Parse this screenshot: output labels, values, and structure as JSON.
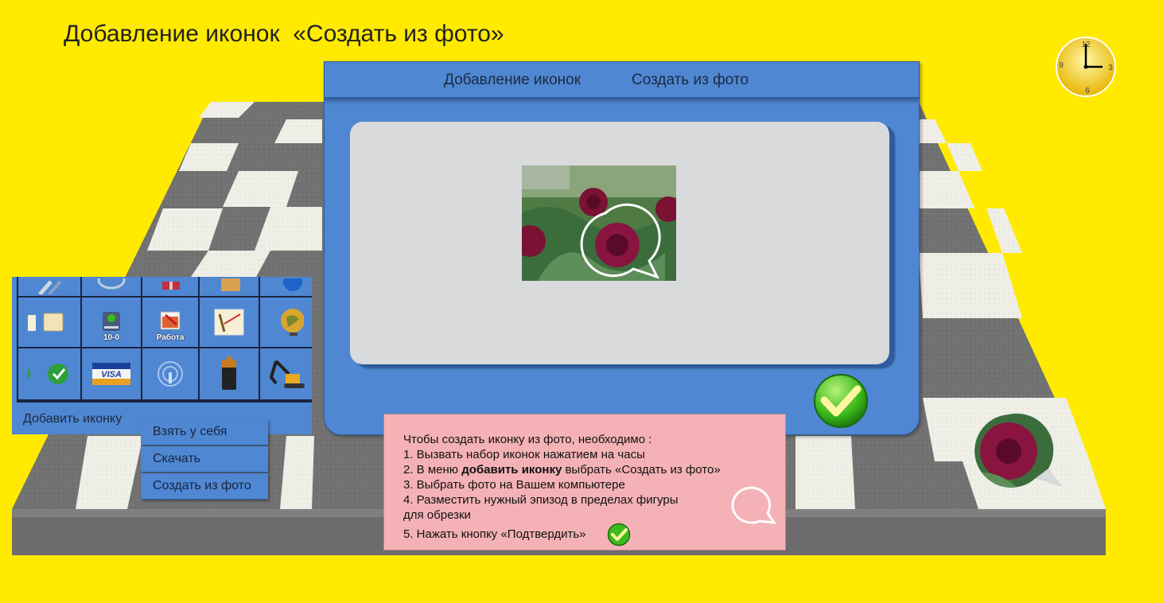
{
  "page": {
    "title": "Добавление иконок  «Создать из фото»"
  },
  "clock": {
    "numbers": [
      "12",
      "3",
      "6",
      "9"
    ]
  },
  "dialog": {
    "header_left": "Добавление иконок",
    "header_right": "Создать из фото",
    "photo_icon": "dahlia-photo",
    "crop_shape": "speech-bubble-outline",
    "confirm_icon": "checkmark-icon"
  },
  "instructions": {
    "intro": "Чтобы создать иконку из фото, необходимо :",
    "step1": "1. Вызвать набор иконок нажатием на часы",
    "step2_pre": "2. В меню ",
    "step2_bold": "добавить иконку",
    "step2_post": " выбрать «Создать из фото»",
    "step3": "3. Выбрать фото на Вашем компьютере",
    "step4a": "4. Разместить нужный эпизод в пределах фигуры",
    "step4b": "для обрезки",
    "step5": "5. Нажать кнопку «Подтвердить»"
  },
  "icon_panel": {
    "cell_labels": {
      "drive": "10-0",
      "work": "Работа"
    },
    "add_label": "Добавить иконку",
    "menu": [
      "Взять у себя",
      "Скачать",
      "Создать из фото"
    ]
  },
  "colors": {
    "background": "#ffea00",
    "panel_blue": "#4f87d2",
    "note_pink": "#f4b2b6",
    "canvas_grey": "#d9dadb"
  }
}
